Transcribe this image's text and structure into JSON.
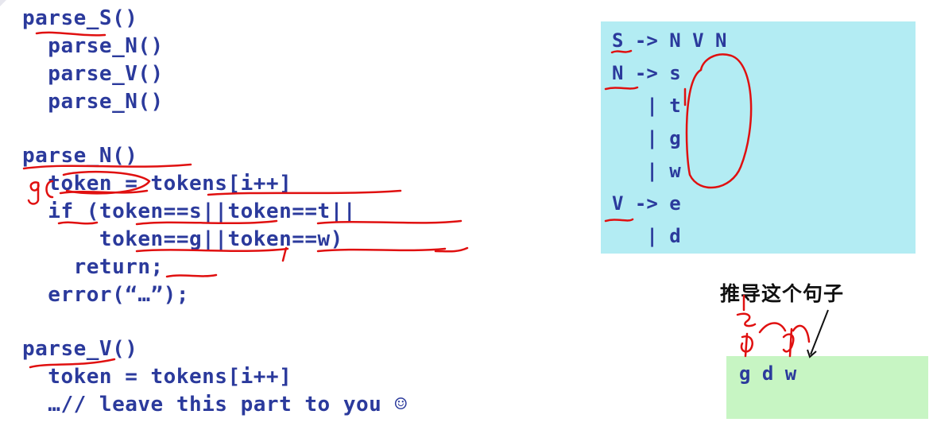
{
  "code_lines": [
    "parse_S()",
    "  parse_N()",
    "  parse_V()",
    "  parse_N()",
    "parse_N()",
    "  token = tokens[i++]",
    "  if (token==s||token==t||",
    "      token==g||token==w)",
    "    return;",
    "  error(“…”);",
    "parse_V()",
    "  token = tokens[i++]",
    "  …// leave this part to you ☺"
  ],
  "grammar_lines": [
    "S -> N V N",
    "N -> s",
    "   | t",
    "   | g",
    "   | w",
    "V -> e",
    "   | d"
  ],
  "caption": "推导这个句子",
  "sentence": "g d w",
  "colors": {
    "code_text": "#2b3a9c",
    "grammar_bg": "#b3ecf3",
    "sentence_bg": "#c7f5c3",
    "annotation_ink": "#e01010"
  }
}
